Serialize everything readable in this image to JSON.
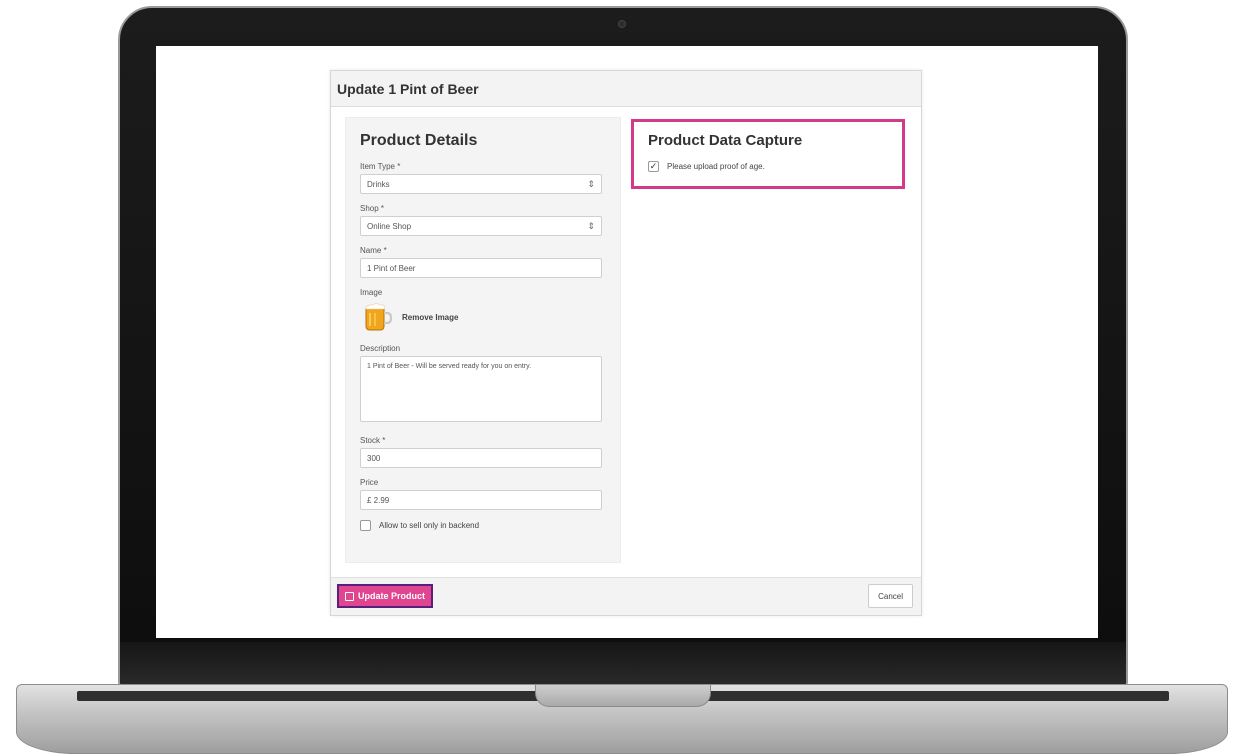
{
  "modal": {
    "title": "Update 1 Pint of Beer"
  },
  "product_details": {
    "title": "Product Details",
    "item_type": {
      "label": "Item Type *",
      "value": "Drinks"
    },
    "shop": {
      "label": "Shop *",
      "value": "Online Shop"
    },
    "name": {
      "label": "Name *",
      "value": "1 Pint of Beer"
    },
    "image": {
      "label": "Image",
      "remove_label": "Remove Image",
      "icon": "beer-mug-icon"
    },
    "description": {
      "label": "Description",
      "value": "1 Pint of Beer - Will be served ready for you on entry."
    },
    "stock": {
      "label": "Stock *",
      "value": "300"
    },
    "price": {
      "label": "Price",
      "value": "£ 2.99"
    },
    "backend_only": {
      "label": "Allow to sell only in backend",
      "checked": false
    }
  },
  "product_data_capture": {
    "title": "Product Data Capture",
    "proof_of_age": {
      "label": "Please upload proof of age.",
      "checked": true
    }
  },
  "footer": {
    "update_label": "Update Product",
    "cancel_label": "Cancel"
  },
  "colors": {
    "highlight": "#d6388a",
    "primary_button": "#e0458f",
    "button_outline": "#58207c"
  }
}
